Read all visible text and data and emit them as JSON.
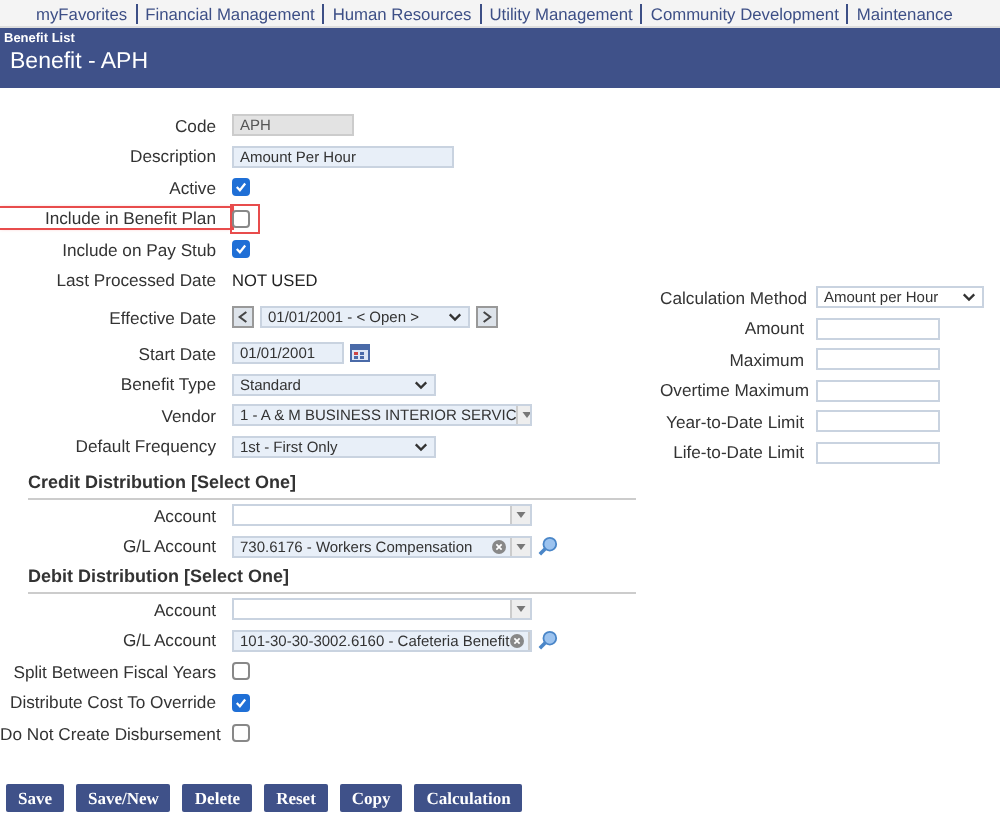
{
  "nav": {
    "items": [
      "myFavorites",
      "Financial Management",
      "Human Resources",
      "Utility Management",
      "Community Development",
      "Maintenance"
    ]
  },
  "header": {
    "breadcrumb": "Benefit List",
    "title": "Benefit - APH"
  },
  "left_fields": [
    {
      "kind": "readonly",
      "label": "Code",
      "value": "APH",
      "highlighted": false
    },
    {
      "kind": "text",
      "label": "Description",
      "value": "Amount Per Hour",
      "highlighted": false
    },
    {
      "kind": "checkbox",
      "label": "Active",
      "checked": true,
      "highlighted": false
    },
    {
      "kind": "checkbox",
      "label": "Include in Benefit Plan",
      "checked": false,
      "highlighted": true
    },
    {
      "kind": "checkbox",
      "label": "Include on Pay Stub",
      "checked": true,
      "highlighted": false
    },
    {
      "kind": "static",
      "label": "Last Processed Date",
      "value": "NOT USED",
      "highlighted": false
    },
    {
      "kind": "date_nav",
      "label": "Effective Date",
      "value": "01/01/2001 - < Open >",
      "highlighted": false
    },
    {
      "kind": "date",
      "label": "Start Date",
      "value": "01/01/2001",
      "highlighted": false
    },
    {
      "kind": "select",
      "label": "Benefit Type",
      "value": "Standard",
      "highlighted": false
    },
    {
      "kind": "combo",
      "label": "Vendor",
      "value": "1 - A & M BUSINESS INTERIOR SERVIC",
      "highlighted": false
    },
    {
      "kind": "select",
      "label": "Default Frequency",
      "value": "1st - First Only",
      "highlighted": false
    }
  ],
  "right_fields": [
    {
      "kind": "select",
      "label": "Calculation Method",
      "value": "Amount per Hour"
    },
    {
      "kind": "text",
      "label": "Amount"
    },
    {
      "kind": "text",
      "label": "Maximum"
    },
    {
      "kind": "text",
      "label": "Overtime Maximum"
    },
    {
      "kind": "text",
      "label": "Year-to-Date Limit"
    },
    {
      "kind": "text",
      "label": "Life-to-Date Limit"
    }
  ],
  "sections": [
    {
      "heading": "Credit Distribution [Select One]",
      "fields": [
        {
          "label": "Account",
          "search": false
        },
        {
          "label": "G/L Account",
          "value": "730.6176 - Workers Compensation",
          "search": true
        }
      ]
    },
    {
      "heading": "Debit Distribution [Select One]",
      "fields": [
        {
          "label": "Account",
          "search": false
        },
        {
          "label": "G/L Account",
          "value": "101-30-30-3002.6160 - Cafeteria  Benefit",
          "search": true
        }
      ]
    }
  ],
  "options": [
    {
      "label": "Split Between Fiscal Years",
      "checked": false
    },
    {
      "label": "Distribute Cost To Override",
      "checked": true
    },
    {
      "label": "Do Not Create Disbursement",
      "checked": false
    }
  ],
  "buttons": [
    "Save",
    "Save/New",
    "Delete",
    "Reset",
    "Copy",
    "Calculation"
  ]
}
